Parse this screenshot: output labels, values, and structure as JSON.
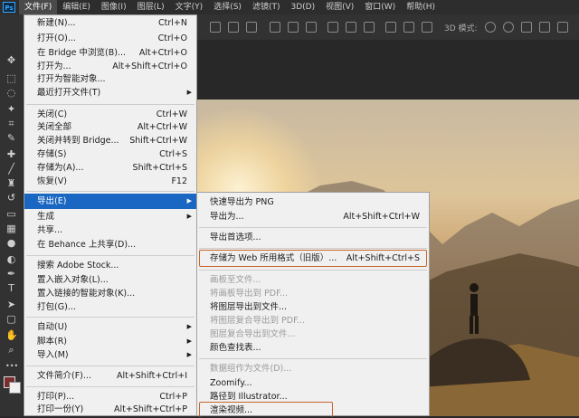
{
  "app": {
    "logo": "Ps"
  },
  "menubar": {
    "items": [
      "文件(F)",
      "编辑(E)",
      "图像(I)",
      "图层(L)",
      "文字(Y)",
      "选择(S)",
      "滤镜(T)",
      "3D(D)",
      "视图(V)",
      "窗口(W)",
      "帮助(H)"
    ],
    "active_index": 0
  },
  "optionsbar": {
    "mode_label": "3D 模式:"
  },
  "file_menu": {
    "items": [
      {
        "label": "新建(N)...",
        "shortcut": "Ctrl+N"
      },
      {
        "label": "打开(O)...",
        "shortcut": "Ctrl+O"
      },
      {
        "label": "在 Bridge 中浏览(B)...",
        "shortcut": "Alt+Ctrl+O"
      },
      {
        "label": "打开为...",
        "shortcut": "Alt+Shift+Ctrl+O"
      },
      {
        "label": "打开为智能对象...",
        "shortcut": ""
      },
      {
        "label": "最近打开文件(T)",
        "shortcut": "",
        "submenu": true
      },
      {
        "label": "关闭(C)",
        "shortcut": "Ctrl+W"
      },
      {
        "label": "关闭全部",
        "shortcut": "Alt+Ctrl+W"
      },
      {
        "label": "关闭并转到 Bridge...",
        "shortcut": "Shift+Ctrl+W"
      },
      {
        "label": "存储(S)",
        "shortcut": "Ctrl+S"
      },
      {
        "label": "存储为(A)...",
        "shortcut": "Shift+Ctrl+S"
      },
      {
        "label": "恢复(V)",
        "shortcut": "F12"
      },
      {
        "label": "导出(E)",
        "shortcut": "",
        "submenu": true,
        "highlighted": true
      },
      {
        "label": "生成",
        "shortcut": "",
        "submenu": true
      },
      {
        "label": "共享...",
        "shortcut": ""
      },
      {
        "label": "在 Behance 上共享(D)...",
        "shortcut": ""
      },
      {
        "label": "搜索 Adobe Stock...",
        "shortcut": ""
      },
      {
        "label": "置入嵌入对象(L)...",
        "shortcut": ""
      },
      {
        "label": "置入链接的智能对象(K)...",
        "shortcut": ""
      },
      {
        "label": "打包(G)...",
        "shortcut": ""
      },
      {
        "label": "自动(U)",
        "shortcut": "",
        "submenu": true
      },
      {
        "label": "脚本(R)",
        "shortcut": "",
        "submenu": true
      },
      {
        "label": "导入(M)",
        "shortcut": "",
        "submenu": true
      },
      {
        "label": "文件简介(F)...",
        "shortcut": "Alt+Shift+Ctrl+I"
      },
      {
        "label": "打印(P)...",
        "shortcut": "Ctrl+P"
      },
      {
        "label": "打印一份(Y)",
        "shortcut": "Alt+Shift+Ctrl+P"
      }
    ]
  },
  "export_menu": {
    "items": [
      {
        "label": "快速导出为 PNG",
        "shortcut": ""
      },
      {
        "label": "导出为...",
        "shortcut": "Alt+Shift+Ctrl+W"
      },
      {
        "label": "导出首选项...",
        "shortcut": ""
      },
      {
        "label": "存储为 Web 所用格式（旧版）...",
        "shortcut": "Alt+Shift+Ctrl+S",
        "outlined": true
      },
      {
        "label": "画板至文件...",
        "shortcut": "",
        "disabled": true
      },
      {
        "label": "将画板导出到 PDF...",
        "shortcut": "",
        "disabled": true
      },
      {
        "label": "将图层导出到文件...",
        "shortcut": ""
      },
      {
        "label": "将图层复合导出到 PDF...",
        "shortcut": "",
        "disabled": true
      },
      {
        "label": "图层复合导出到文件...",
        "shortcut": "",
        "disabled": true
      },
      {
        "label": "颜色查找表...",
        "shortcut": ""
      },
      {
        "label": "数据组作为文件(D)...",
        "shortcut": "",
        "disabled": true
      },
      {
        "label": "Zoomify...",
        "shortcut": ""
      },
      {
        "label": "路径到 Illustrator...",
        "shortcut": ""
      },
      {
        "label": "渲染视频...",
        "shortcut": "",
        "outlined": true
      }
    ]
  },
  "colors": {
    "highlight": "#1967c2",
    "outline": "#c8642d",
    "foreground_swatch": "#7a2e2e",
    "background_swatch": "#f1f1f1"
  },
  "tools": [
    "move-icon",
    "marquee-icon",
    "lasso-icon",
    "magic-wand-icon",
    "crop-icon",
    "eyedropper-icon",
    "healing-brush-icon",
    "brush-icon",
    "clone-stamp-icon",
    "history-brush-icon",
    "eraser-icon",
    "gradient-icon",
    "blur-icon",
    "dodge-icon",
    "pen-icon",
    "type-icon",
    "path-selection-icon",
    "shape-icon",
    "hand-icon",
    "zoom-icon"
  ]
}
